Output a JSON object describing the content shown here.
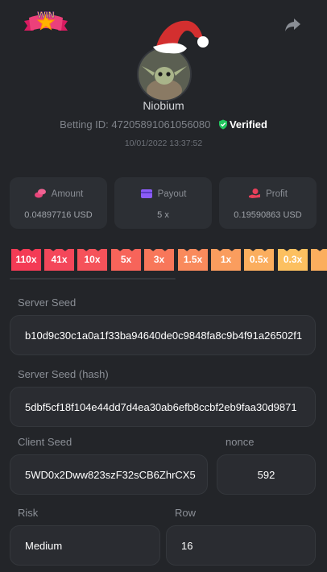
{
  "header": {
    "badge_icon": "win-star-badge-icon",
    "share_icon": "share-arrow-icon"
  },
  "profile": {
    "username": "Niobium",
    "betting_id_label": "Betting ID:",
    "betting_id": "47205891061056080",
    "verified_label": "Verified",
    "datetime": "10/01/2022 13:37:52"
  },
  "stats": {
    "amount": {
      "label": "Amount",
      "value": "0.04897716 USD",
      "icon": "coins-icon",
      "color": "#e8457a"
    },
    "payout": {
      "label": "Payout",
      "value": "5 x",
      "icon": "wallet-icon",
      "color": "#8b5cf6"
    },
    "profit": {
      "label": "Profit",
      "value": "0.19590863 USD",
      "icon": "hand-coin-icon",
      "color": "#e8405a"
    }
  },
  "multipliers": [
    {
      "label": "110x",
      "color": "#f43b55"
    },
    {
      "label": "41x",
      "color": "#f4475a"
    },
    {
      "label": "10x",
      "color": "#f5525a"
    },
    {
      "label": "5x",
      "color": "#f7645a"
    },
    {
      "label": "3x",
      "color": "#f8775a"
    },
    {
      "label": "1.5x",
      "color": "#f98a5c"
    },
    {
      "label": "1x",
      "color": "#fa9d5e"
    },
    {
      "label": "0.5x",
      "color": "#fbae5e"
    },
    {
      "label": "0.3x",
      "color": "#fcc060"
    },
    {
      "label": "",
      "color": "#fbae5e"
    }
  ],
  "fields": {
    "server_seed": {
      "label": "Server Seed",
      "value": "b10d9c30c1a0a1f33ba94640de0c9848fa8c9b4f91a26502f1"
    },
    "server_seed_hash": {
      "label": "Server Seed (hash)",
      "value": "5dbf5cf18f104e44dd7d4ea30ab6efb8ccbf2eb9faa30d9871"
    },
    "client_seed": {
      "label": "Client Seed",
      "value": "5WD0x2Dww823szF32sCB6ZhrCX5"
    },
    "nonce": {
      "label": "nonce",
      "value": "592"
    },
    "risk": {
      "label": "Risk",
      "value": "Medium"
    },
    "row": {
      "label": "Row",
      "value": "16"
    }
  },
  "colors": {
    "background": "#232529",
    "card": "#2c2f34",
    "verified_shield": "#22c55e"
  }
}
